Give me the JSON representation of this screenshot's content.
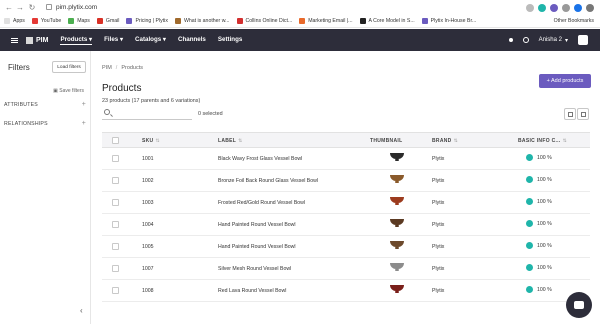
{
  "browser": {
    "url": "pim.plytix.com",
    "bookmarks": [
      {
        "label": "Apps",
        "color": "#e0e0e0"
      },
      {
        "label": "YouTube",
        "color": "#e53935"
      },
      {
        "label": "Maps",
        "color": "#4caf50"
      },
      {
        "label": "Gmail",
        "color": "#d93025"
      },
      {
        "label": "Pricing | Plytix",
        "color": "#6b5bbf"
      },
      {
        "label": "What is another w...",
        "color": "#a06a2c"
      },
      {
        "label": "Collins Online Dict...",
        "color": "#d32f2f"
      },
      {
        "label": "Marketing Email |...",
        "color": "#e96a2b"
      },
      {
        "label": "A Core Model in S...",
        "color": "#222222"
      },
      {
        "label": "Plytix In-House Br...",
        "color": "#6b5bbf"
      }
    ],
    "other_bookmarks": "Other Bookmarks"
  },
  "header": {
    "logo": "PIM",
    "menu": [
      "Products",
      "Files",
      "Catalogs",
      "Channels",
      "Settings"
    ],
    "user": "Anisha 2"
  },
  "sidebar": {
    "title": "Filters",
    "load_filters": "Load filters",
    "save_filters": "Save filters",
    "sections": [
      "ATTRIBUTES",
      "RELATIONSHIPS"
    ]
  },
  "main": {
    "breadcrumb": [
      "PIM",
      "Products"
    ],
    "add_button": "+ Add products",
    "title": "Products",
    "summary": "23 products (17 parents and 6 variations)",
    "search_placeholder": "",
    "selected": "0 selected",
    "columns": {
      "sku": "SKU",
      "label": "LABEL",
      "thumbnail": "THUMBNAIL",
      "brand": "BRAND",
      "basic": "BASIC INFO C..."
    },
    "rows": [
      {
        "sku": "1001",
        "label": "Black Wavy Frost Glass Vessel Bowl",
        "brand": "Plytix",
        "status": "100 %",
        "thumb_color": "#2b2b2b"
      },
      {
        "sku": "1002",
        "label": "Bronze Foil Back Round Glass Vessel Bowl",
        "brand": "Plytix",
        "status": "100 %",
        "thumb_color": "#8a5a2b"
      },
      {
        "sku": "1003",
        "label": "Frosted Red/Gold Round Vessel Bowl",
        "brand": "Plytix",
        "status": "100 %",
        "thumb_color": "#9c3b1e"
      },
      {
        "sku": "1004",
        "label": "Hand Painted Round Vessel Bowl",
        "brand": "Plytix",
        "status": "100 %",
        "thumb_color": "#5b3a22"
      },
      {
        "sku": "1005",
        "label": "Hand Painted Round Vessel Bowl",
        "brand": "Plytix",
        "status": "100 %",
        "thumb_color": "#6d4a2c"
      },
      {
        "sku": "1007",
        "label": "Silver Mesh Round Vessel Bowl",
        "brand": "Plytix",
        "status": "100 %",
        "thumb_color": "#8c8c8c"
      },
      {
        "sku": "1008",
        "label": "Red Lava Round Vessel Bowl",
        "brand": "Plytix",
        "status": "100 %",
        "thumb_color": "#7a1f1a"
      }
    ]
  },
  "colors": {
    "accent": "#6b5bbf",
    "header_bg": "#2d2d3a",
    "status_green": "#1fb5aa"
  }
}
